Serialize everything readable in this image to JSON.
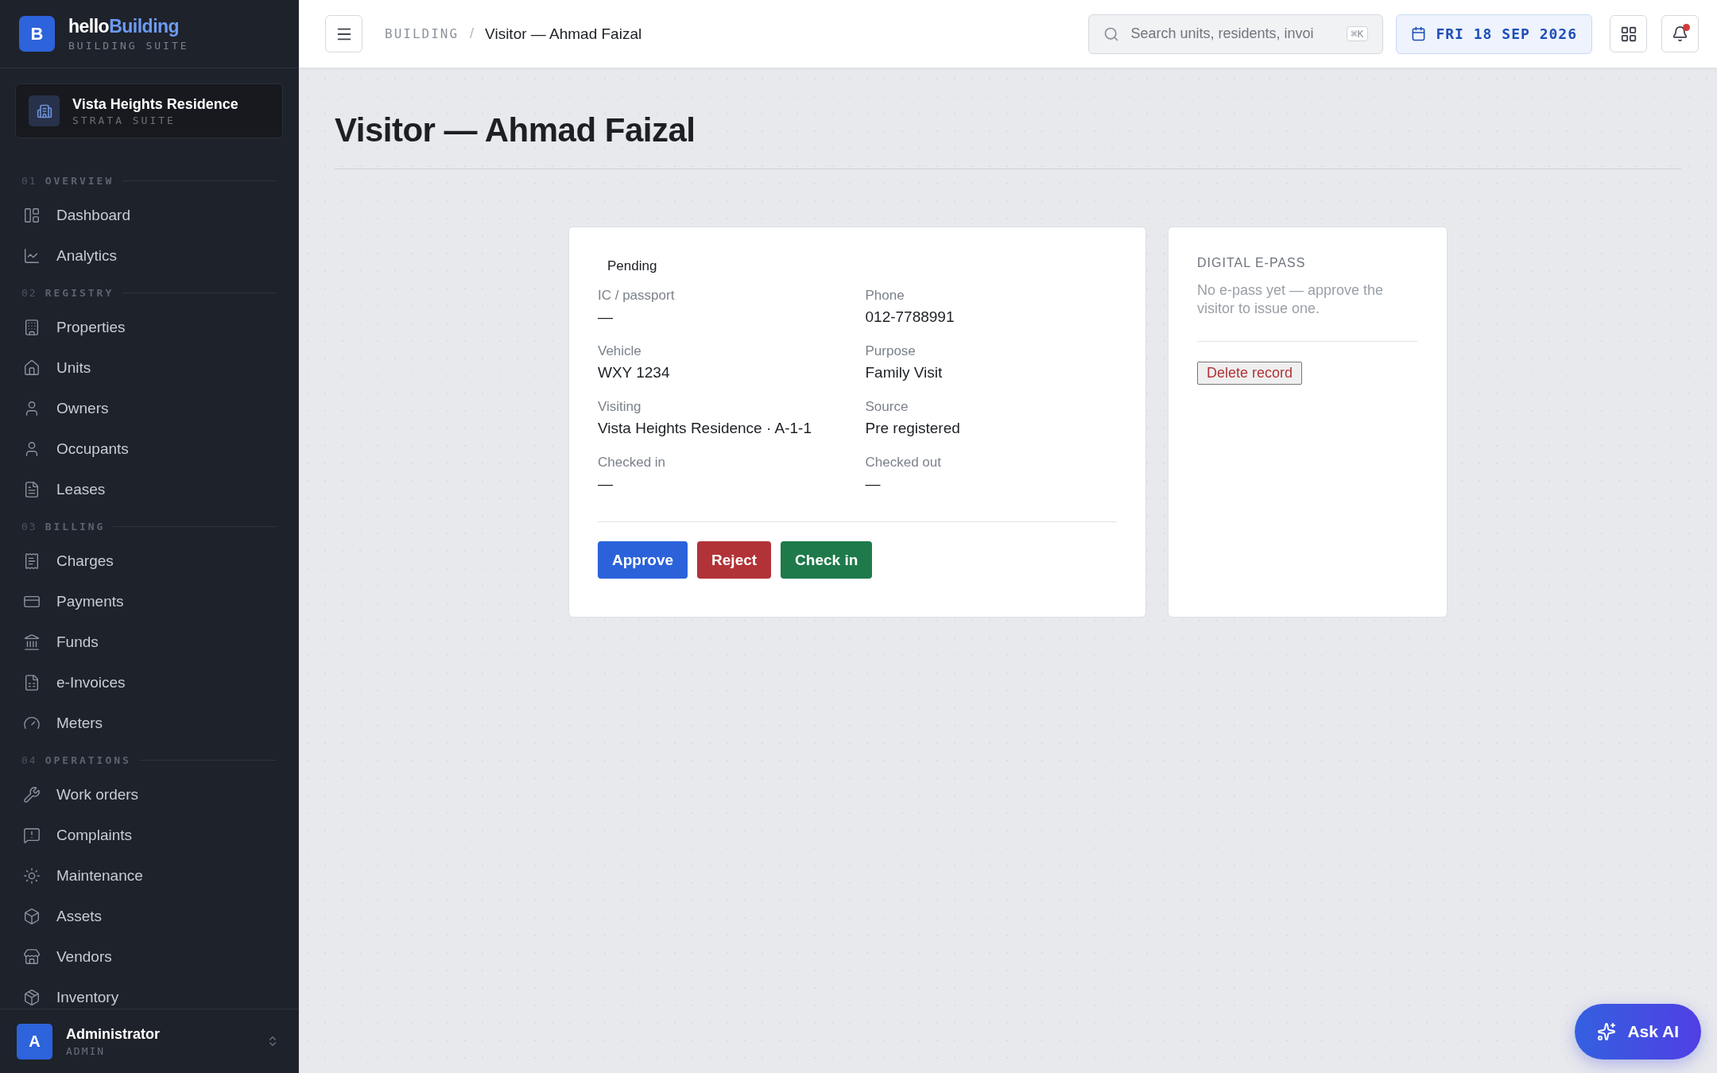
{
  "brand": {
    "name_part1": "hello",
    "name_part2": "Building",
    "subtitle": "BUILDING SUITE",
    "logo_letter": "B"
  },
  "property": {
    "name": "Vista Heights Residence",
    "subtitle": "STRATA SUITE"
  },
  "nav_sections": [
    {
      "number": "01",
      "title": "OVERVIEW",
      "items": [
        {
          "label": "Dashboard"
        },
        {
          "label": "Analytics"
        }
      ]
    },
    {
      "number": "02",
      "title": "REGISTRY",
      "items": [
        {
          "label": "Properties"
        },
        {
          "label": "Units"
        },
        {
          "label": "Owners"
        },
        {
          "label": "Occupants"
        },
        {
          "label": "Leases"
        }
      ]
    },
    {
      "number": "03",
      "title": "BILLING",
      "items": [
        {
          "label": "Charges"
        },
        {
          "label": "Payments"
        },
        {
          "label": "Funds"
        },
        {
          "label": "e-Invoices"
        },
        {
          "label": "Meters"
        }
      ]
    },
    {
      "number": "04",
      "title": "OPERATIONS",
      "items": [
        {
          "label": "Work orders"
        },
        {
          "label": "Complaints"
        },
        {
          "label": "Maintenance"
        },
        {
          "label": "Assets"
        },
        {
          "label": "Vendors"
        },
        {
          "label": "Inventory"
        }
      ]
    }
  ],
  "user": {
    "avatar_letter": "A",
    "name": "Administrator",
    "role": "ADMIN"
  },
  "topbar": {
    "breadcrumb": [
      {
        "label": "BUILDING"
      },
      {
        "label": "Visitor — Ahmad Faizal"
      }
    ],
    "breadcrumb_separator": "/",
    "search": {
      "placeholder": "Search units, residents, invoi",
      "shortcut": "⌘K"
    },
    "date": "FRI 18 SEP 2026",
    "notification_unread": true
  },
  "page": {
    "title": "Visitor — Ahmad Faizal"
  },
  "visitor_card": {
    "status": "Pending",
    "fields": [
      {
        "label": "IC / passport",
        "value": "—"
      },
      {
        "label": "Phone",
        "value": "012-7788991"
      },
      {
        "label": "Vehicle",
        "value": "WXY 1234"
      },
      {
        "label": "Purpose",
        "value": "Family Visit"
      },
      {
        "label": "Visiting",
        "value": "Vista Heights Residence · A-1-1"
      },
      {
        "label": "Source",
        "value": "Pre registered"
      },
      {
        "label": "Checked in",
        "value": "—"
      },
      {
        "label": "Checked out",
        "value": "—"
      }
    ],
    "actions": [
      {
        "label": "Approve",
        "kind": "primary"
      },
      {
        "label": "Reject",
        "kind": "danger"
      },
      {
        "label": "Check in",
        "kind": "success"
      }
    ]
  },
  "epass_card": {
    "title": "DIGITAL E-PASS",
    "message": "No e-pass yet — approve the visitor to issue one.",
    "delete_button": "Delete record"
  },
  "ask_ai": {
    "label": "Ask AI"
  }
}
